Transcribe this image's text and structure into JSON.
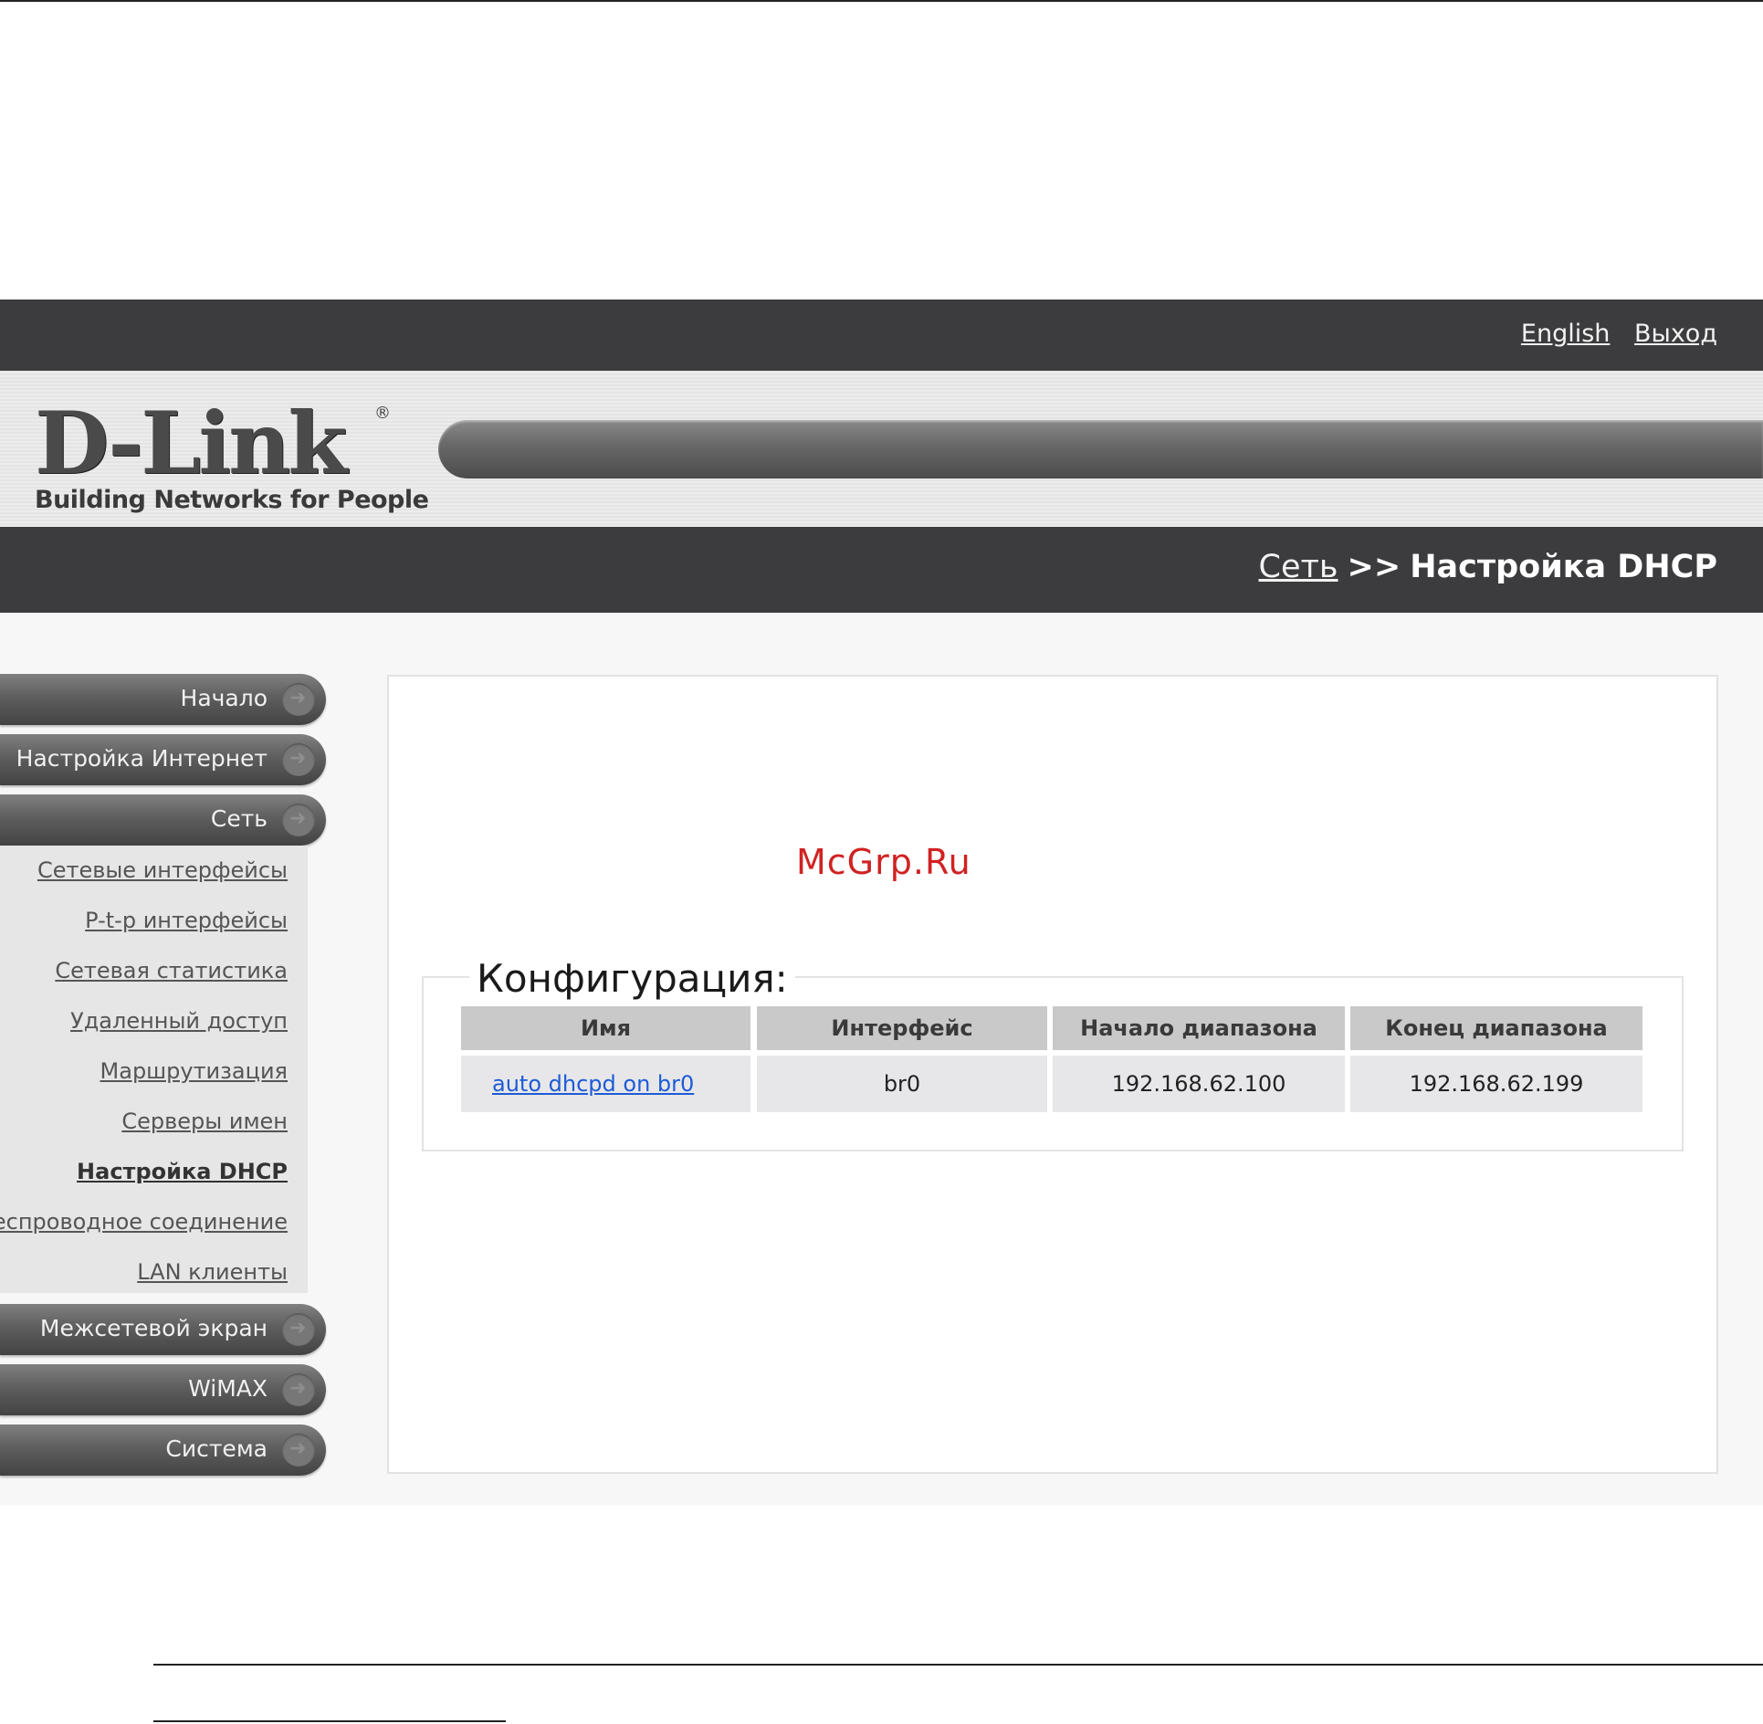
{
  "header": {
    "links": [
      "English",
      "Выход"
    ],
    "logo_text": "D-Link",
    "logo_tagline": "Building Networks for People",
    "logo_reg": "®"
  },
  "breadcrumb": {
    "parent": "Сеть",
    "separator": ">>",
    "current": "Настройка DHCP"
  },
  "sidebar": {
    "items": [
      {
        "label": "Начало"
      },
      {
        "label": "Настройка Интернет"
      },
      {
        "label": "Сеть"
      },
      {
        "label": "Межсетевой экран"
      },
      {
        "label": "WiMAX"
      },
      {
        "label": "Система"
      }
    ],
    "subitems": [
      {
        "label": "Сетевые интерфейсы"
      },
      {
        "label": "P-t-p интерфейсы"
      },
      {
        "label": "Сетевая статистика"
      },
      {
        "label": "Удаленный доступ"
      },
      {
        "label": "Маршрутизация"
      },
      {
        "label": "Серверы имен"
      },
      {
        "label": "Настройка DHCP",
        "active": true
      },
      {
        "label": "Беспроводное соединение"
      },
      {
        "label": "LAN клиенты"
      }
    ]
  },
  "main": {
    "watermark": "McGrp.Ru",
    "section_title": "Конфигурация:",
    "table": {
      "headers": [
        "Имя",
        "Интерфейс",
        "Начало диапазона",
        "Конец диапазона"
      ],
      "rows": [
        [
          "auto dhcpd on br0",
          "br0",
          "192.168.62.100",
          "192.168.62.199"
        ]
      ]
    }
  },
  "colors": {
    "header_bg": "#3c3c3e",
    "link_blue": "#1d5bd6",
    "watermark_red": "#d02222",
    "table_header_bg": "#c9c9c9",
    "table_cell_bg": "#e7e7e9"
  }
}
